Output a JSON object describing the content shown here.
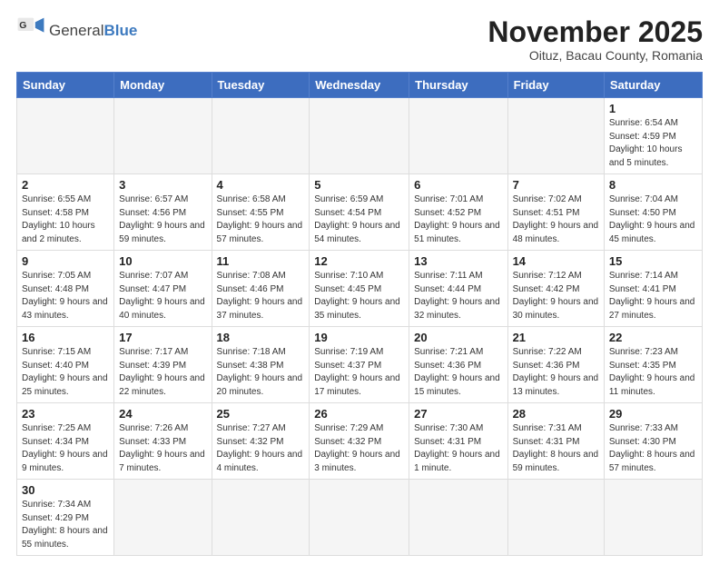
{
  "logo": {
    "text_general": "General",
    "text_blue": "Blue"
  },
  "title": "November 2025",
  "subtitle": "Oituz, Bacau County, Romania",
  "days_of_week": [
    "Sunday",
    "Monday",
    "Tuesday",
    "Wednesday",
    "Thursday",
    "Friday",
    "Saturday"
  ],
  "weeks": [
    [
      {
        "day": "",
        "info": ""
      },
      {
        "day": "",
        "info": ""
      },
      {
        "day": "",
        "info": ""
      },
      {
        "day": "",
        "info": ""
      },
      {
        "day": "",
        "info": ""
      },
      {
        "day": "",
        "info": ""
      },
      {
        "day": "1",
        "info": "Sunrise: 6:54 AM\nSunset: 4:59 PM\nDaylight: 10 hours and 5 minutes."
      }
    ],
    [
      {
        "day": "2",
        "info": "Sunrise: 6:55 AM\nSunset: 4:58 PM\nDaylight: 10 hours and 2 minutes."
      },
      {
        "day": "3",
        "info": "Sunrise: 6:57 AM\nSunset: 4:56 PM\nDaylight: 9 hours and 59 minutes."
      },
      {
        "day": "4",
        "info": "Sunrise: 6:58 AM\nSunset: 4:55 PM\nDaylight: 9 hours and 57 minutes."
      },
      {
        "day": "5",
        "info": "Sunrise: 6:59 AM\nSunset: 4:54 PM\nDaylight: 9 hours and 54 minutes."
      },
      {
        "day": "6",
        "info": "Sunrise: 7:01 AM\nSunset: 4:52 PM\nDaylight: 9 hours and 51 minutes."
      },
      {
        "day": "7",
        "info": "Sunrise: 7:02 AM\nSunset: 4:51 PM\nDaylight: 9 hours and 48 minutes."
      },
      {
        "day": "8",
        "info": "Sunrise: 7:04 AM\nSunset: 4:50 PM\nDaylight: 9 hours and 45 minutes."
      }
    ],
    [
      {
        "day": "9",
        "info": "Sunrise: 7:05 AM\nSunset: 4:48 PM\nDaylight: 9 hours and 43 minutes."
      },
      {
        "day": "10",
        "info": "Sunrise: 7:07 AM\nSunset: 4:47 PM\nDaylight: 9 hours and 40 minutes."
      },
      {
        "day": "11",
        "info": "Sunrise: 7:08 AM\nSunset: 4:46 PM\nDaylight: 9 hours and 37 minutes."
      },
      {
        "day": "12",
        "info": "Sunrise: 7:10 AM\nSunset: 4:45 PM\nDaylight: 9 hours and 35 minutes."
      },
      {
        "day": "13",
        "info": "Sunrise: 7:11 AM\nSunset: 4:44 PM\nDaylight: 9 hours and 32 minutes."
      },
      {
        "day": "14",
        "info": "Sunrise: 7:12 AM\nSunset: 4:42 PM\nDaylight: 9 hours and 30 minutes."
      },
      {
        "day": "15",
        "info": "Sunrise: 7:14 AM\nSunset: 4:41 PM\nDaylight: 9 hours and 27 minutes."
      }
    ],
    [
      {
        "day": "16",
        "info": "Sunrise: 7:15 AM\nSunset: 4:40 PM\nDaylight: 9 hours and 25 minutes."
      },
      {
        "day": "17",
        "info": "Sunrise: 7:17 AM\nSunset: 4:39 PM\nDaylight: 9 hours and 22 minutes."
      },
      {
        "day": "18",
        "info": "Sunrise: 7:18 AM\nSunset: 4:38 PM\nDaylight: 9 hours and 20 minutes."
      },
      {
        "day": "19",
        "info": "Sunrise: 7:19 AM\nSunset: 4:37 PM\nDaylight: 9 hours and 17 minutes."
      },
      {
        "day": "20",
        "info": "Sunrise: 7:21 AM\nSunset: 4:36 PM\nDaylight: 9 hours and 15 minutes."
      },
      {
        "day": "21",
        "info": "Sunrise: 7:22 AM\nSunset: 4:36 PM\nDaylight: 9 hours and 13 minutes."
      },
      {
        "day": "22",
        "info": "Sunrise: 7:23 AM\nSunset: 4:35 PM\nDaylight: 9 hours and 11 minutes."
      }
    ],
    [
      {
        "day": "23",
        "info": "Sunrise: 7:25 AM\nSunset: 4:34 PM\nDaylight: 9 hours and 9 minutes."
      },
      {
        "day": "24",
        "info": "Sunrise: 7:26 AM\nSunset: 4:33 PM\nDaylight: 9 hours and 7 minutes."
      },
      {
        "day": "25",
        "info": "Sunrise: 7:27 AM\nSunset: 4:32 PM\nDaylight: 9 hours and 4 minutes."
      },
      {
        "day": "26",
        "info": "Sunrise: 7:29 AM\nSunset: 4:32 PM\nDaylight: 9 hours and 3 minutes."
      },
      {
        "day": "27",
        "info": "Sunrise: 7:30 AM\nSunset: 4:31 PM\nDaylight: 9 hours and 1 minute."
      },
      {
        "day": "28",
        "info": "Sunrise: 7:31 AM\nSunset: 4:31 PM\nDaylight: 8 hours and 59 minutes."
      },
      {
        "day": "29",
        "info": "Sunrise: 7:33 AM\nSunset: 4:30 PM\nDaylight: 8 hours and 57 minutes."
      }
    ],
    [
      {
        "day": "30",
        "info": "Sunrise: 7:34 AM\nSunset: 4:29 PM\nDaylight: 8 hours and 55 minutes."
      },
      {
        "day": "",
        "info": ""
      },
      {
        "day": "",
        "info": ""
      },
      {
        "day": "",
        "info": ""
      },
      {
        "day": "",
        "info": ""
      },
      {
        "day": "",
        "info": ""
      },
      {
        "day": "",
        "info": ""
      }
    ]
  ]
}
